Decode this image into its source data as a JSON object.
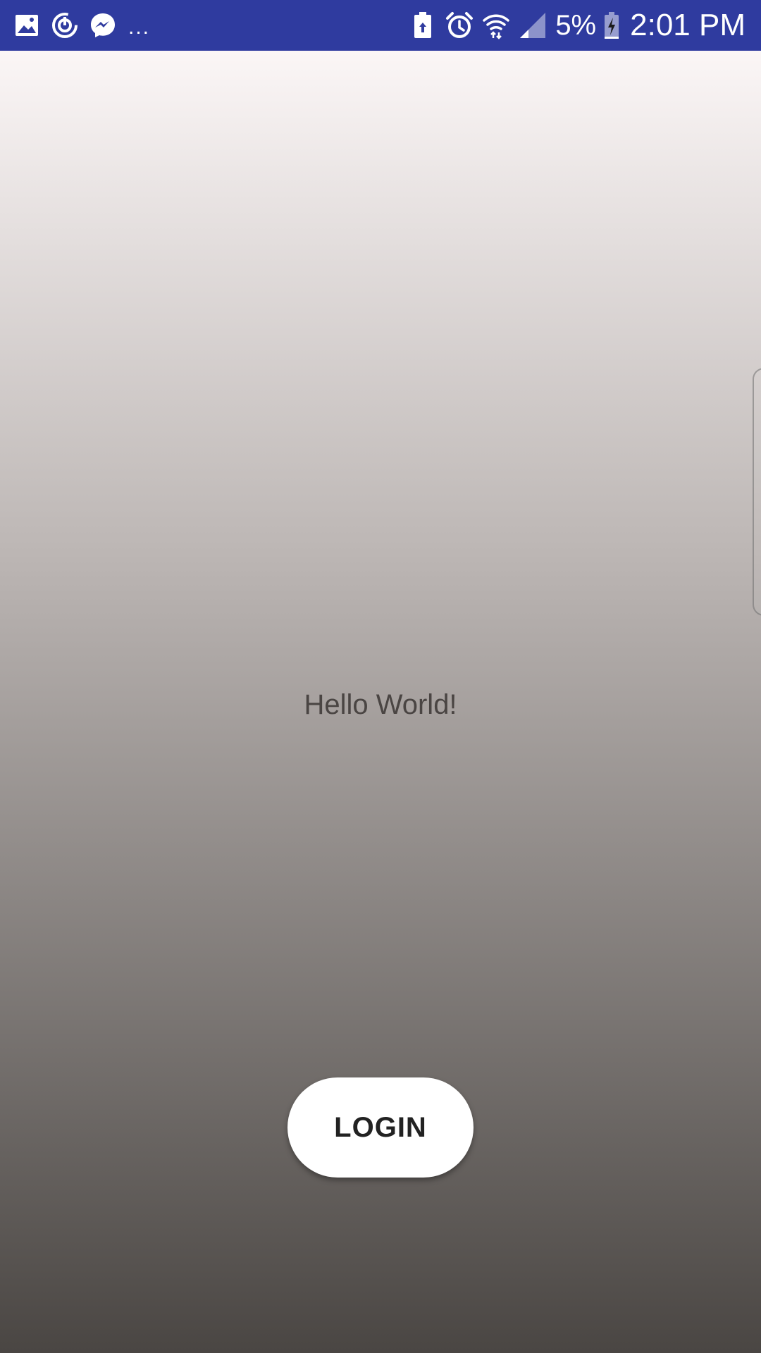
{
  "colors": {
    "status_bar_bg": "#2f3b9f",
    "gradient_top": "#fbf6f6",
    "gradient_mid": "#bdb7b5",
    "gradient_bottom": "#4a4643",
    "hello_text": "#4a4543",
    "button_bg": "#ffffff",
    "button_text": "#222222"
  },
  "status_bar": {
    "left_icons": [
      "image-icon",
      "sync-icon",
      "messenger-icon"
    ],
    "more_indicator": "...",
    "right_icons": [
      "battery-saver-icon",
      "alarm-icon",
      "wifi-icon",
      "signal-icon"
    ],
    "battery_percent": "5%",
    "battery_icon": "battery-charging-icon",
    "time": "2:01 PM"
  },
  "main": {
    "greeting": "Hello World!",
    "login_label": "LOGIN"
  }
}
